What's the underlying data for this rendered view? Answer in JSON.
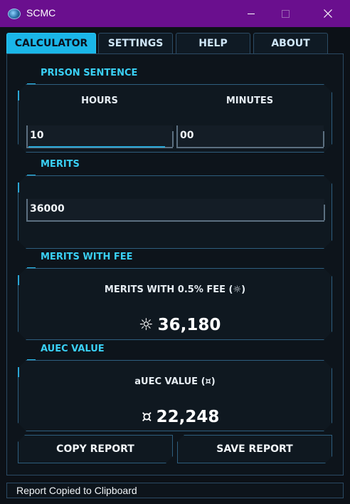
{
  "window": {
    "title": "SCMC"
  },
  "tabs": [
    {
      "label": "CALCULATOR",
      "active": true
    },
    {
      "label": "SETTINGS",
      "active": false
    },
    {
      "label": "HELP",
      "active": false
    },
    {
      "label": "ABOUT",
      "active": false
    }
  ],
  "prison_sentence": {
    "label": "PRISON SENTENCE",
    "hours_label": "HOURS",
    "minutes_label": "MINUTES",
    "hours_value": "10",
    "minutes_value": "00"
  },
  "merits": {
    "label": "MERITS",
    "value": "36000"
  },
  "merits_with_fee": {
    "label": "MERITS WITH FEE",
    "heading": "MERITS WITH 0.5% FEE (☼)",
    "symbol": "☼",
    "value": "36,180"
  },
  "auec_value": {
    "label": "AUEC VALUE",
    "heading": "aUEC VALUE (¤)",
    "symbol": "¤",
    "value": "22,248"
  },
  "buttons": {
    "copy_report": "COPY REPORT",
    "save_report": "SAVE REPORT"
  },
  "status": {
    "text": "Report Copied to Clipboard"
  },
  "colors": {
    "title_bar": "#6a0f8e",
    "accent": "#3ad0f5",
    "active_tab": "#1ab6e8",
    "background": "#0c1117"
  }
}
